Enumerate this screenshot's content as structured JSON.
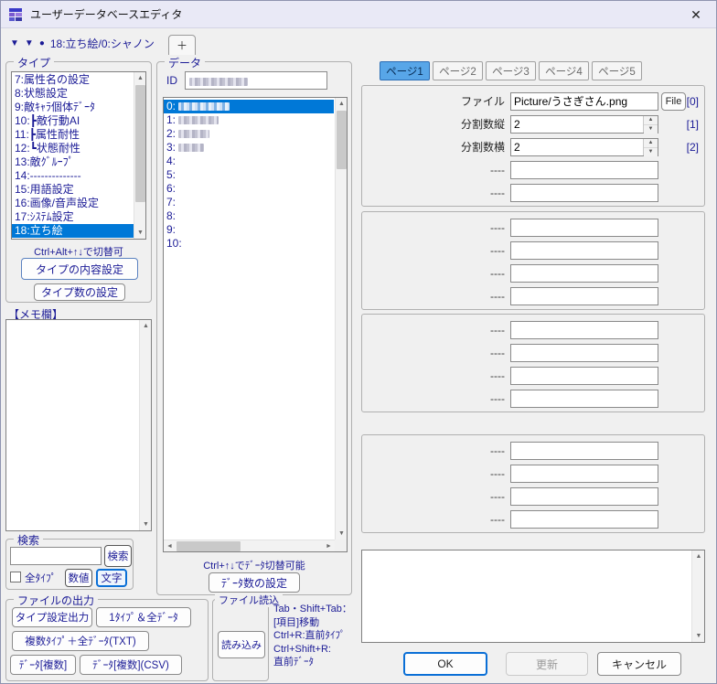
{
  "window": {
    "title": "ユーザーデータベースエディタ",
    "close_label": "✕"
  },
  "nav": {
    "prev_icon": "▼",
    "next_icon": "▼",
    "bullet_icon": "●",
    "current_label": "18:立ち絵/0:シャノン",
    "add_tab_label": "＋"
  },
  "icons": {
    "up_arrow": "▲",
    "down_arrow": "▼",
    "left_arrow": "◄",
    "right_arrow": "►"
  },
  "type_panel": {
    "group_label": "タイプ",
    "items": [
      {
        "label": "7:属性名の設定",
        "selected": false
      },
      {
        "label": "8:状態設定",
        "selected": false
      },
      {
        "label": "9:敵ｷｬﾗ個体ﾃﾞｰﾀ",
        "selected": false
      },
      {
        "label": "10:┣敵行動AI",
        "selected": false
      },
      {
        "label": "11:┣属性耐性",
        "selected": false
      },
      {
        "label": "12:┗状態耐性",
        "selected": false
      },
      {
        "label": "13:敵ｸﾞﾙｰﾌﾟ",
        "selected": false
      },
      {
        "label": "14:--------------",
        "selected": false
      },
      {
        "label": "15:用語設定",
        "selected": false
      },
      {
        "label": "16:画像/音声設定",
        "selected": false
      },
      {
        "label": "17:ｼｽﾃﾑ設定",
        "selected": false
      },
      {
        "label": "18:立ち絵",
        "selected": true
      }
    ],
    "switch_hint": "Ctrl+Alt+↑↓で切替可",
    "content_button": "タイプの内容設定",
    "count_button": "タイプ数の設定"
  },
  "memo": {
    "label": "【メモ欄】",
    "value": ""
  },
  "search": {
    "group_label": "検索",
    "input_value": "",
    "search_button": "検索",
    "all_types_label": "全ﾀｲﾌﾟ",
    "numeric_button": "数値",
    "text_button": "文字"
  },
  "file_output": {
    "group_label": "ファイルの出力",
    "type_setting_button": "タイプ設定出力",
    "one_type_all_data_button": "1ﾀｲﾌﾟ＆全ﾃﾞｰﾀ",
    "multi_type_txt_button": "複数ﾀｲﾌﾟ＋全ﾃﾞｰﾀ(TXT)",
    "data_multi_button": "ﾃﾞｰﾀ[複数]",
    "data_multi_csv_button": "ﾃﾞｰﾀ[複数](CSV)"
  },
  "data_panel": {
    "group_label": "データ",
    "id_label": "ID",
    "id_value_redacted": true,
    "items": [
      {
        "num": "0:",
        "selected": true,
        "redacted": true
      },
      {
        "num": "1:",
        "selected": false,
        "redacted": true
      },
      {
        "num": "2:",
        "selected": false,
        "redacted": true
      },
      {
        "num": "3:",
        "selected": false,
        "redacted": true
      },
      {
        "num": "4:",
        "selected": false,
        "redacted": false
      },
      {
        "num": "5:",
        "selected": false,
        "redacted": false
      },
      {
        "num": "6:",
        "selected": false,
        "redacted": false
      },
      {
        "num": "7:",
        "selected": false,
        "redacted": false
      },
      {
        "num": "8:",
        "selected": false,
        "redacted": false
      },
      {
        "num": "9:",
        "selected": false,
        "redacted": false
      },
      {
        "num": "10:",
        "selected": false,
        "redacted": false
      }
    ],
    "switch_hint": "Ctrl+↑↓でﾃﾞｰﾀ切替可能",
    "count_button": "ﾃﾞｰﾀ数の設定"
  },
  "file_load": {
    "group_label": "ファイル読込",
    "load_button": "読み込み"
  },
  "shortcut_help": {
    "line1": "Tab・Shift+Tab：",
    "line2": "[項目]移動",
    "line3": "Ctrl+R:直前ﾀｲﾌﾟ",
    "line4": "Ctrl+Shift+R:",
    "line5": "直前ﾃﾞｰﾀ"
  },
  "page_panel": {
    "tabs": [
      {
        "label": "ページ1",
        "selected": true
      },
      {
        "label": "ページ2",
        "selected": false
      },
      {
        "label": "ページ3",
        "selected": false
      },
      {
        "label": "ページ4",
        "selected": false
      },
      {
        "label": "ページ5",
        "selected": false
      }
    ],
    "file_field": {
      "label": "ファイル",
      "value": "Picture/うさぎさん.png",
      "button": "File",
      "index": "[0]"
    },
    "split_v_field": {
      "label": "分割数縦",
      "value": "2",
      "index": "[1]"
    },
    "split_h_field": {
      "label": "分割数横",
      "value": "2",
      "index": "[2]"
    },
    "empty_label": "----",
    "comment_value": "",
    "ok_button": "OK",
    "update_button": "更新",
    "cancel_button": "キャンセル"
  },
  "colors": {
    "selection": "#0078d7",
    "accent_navy": "#1b1b96",
    "tab_selected": "#58a6e8",
    "titlebar": "#e9e9f6"
  }
}
